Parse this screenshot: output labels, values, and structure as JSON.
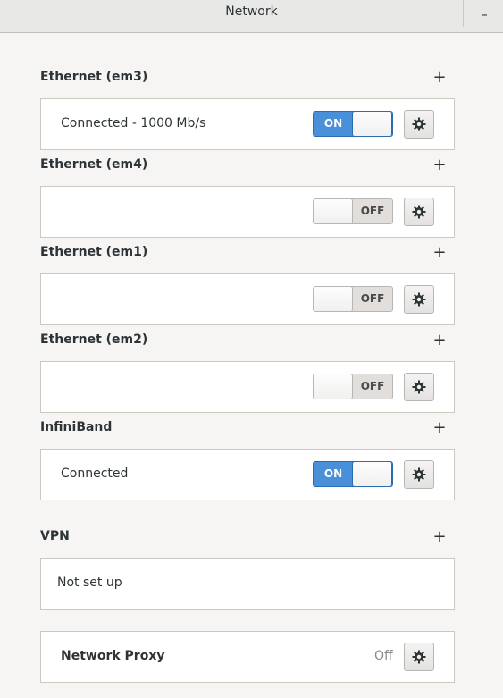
{
  "window": {
    "title": "Network",
    "minimize_label": "–"
  },
  "devices": [
    {
      "label": "Ethernet (em3)",
      "status": "Connected - 1000 Mb/s",
      "switch": "ON",
      "state": "on"
    },
    {
      "label": "Ethernet (em4)",
      "status": "",
      "switch": "OFF",
      "state": "off"
    },
    {
      "label": "Ethernet (em1)",
      "status": "",
      "switch": "OFF",
      "state": "off"
    },
    {
      "label": "Ethernet (em2)",
      "status": "",
      "switch": "OFF",
      "state": "off"
    },
    {
      "label": "InfiniBand",
      "status": "Connected",
      "switch": "ON",
      "state": "on"
    }
  ],
  "add_label": "+",
  "vpn": {
    "label": "VPN",
    "status": "Not set up"
  },
  "proxy": {
    "label": "Network Proxy",
    "value": "Off"
  },
  "colors": {
    "accent": "#4a90d9",
    "background": "#f6f5f4",
    "card": "#ffffff"
  },
  "icons": {
    "settings": "gear-icon",
    "add": "plus-icon",
    "minimize": "minimize-icon"
  }
}
